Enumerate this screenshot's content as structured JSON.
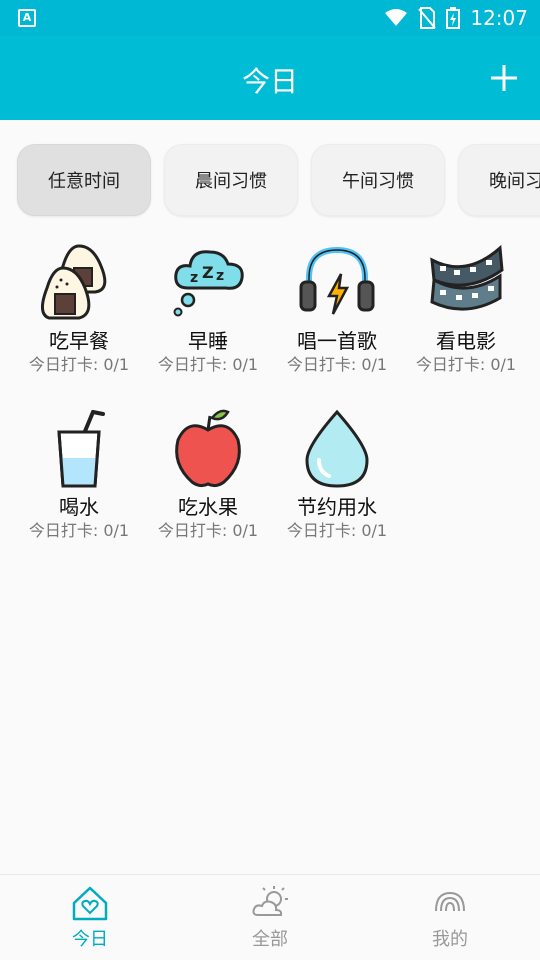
{
  "status": {
    "app_badge": "A",
    "time": "12:07"
  },
  "appbar": {
    "title": "今日",
    "add_icon": "plus-icon"
  },
  "chips": [
    {
      "label": "任意时间",
      "active": true
    },
    {
      "label": "晨间习惯",
      "active": false
    },
    {
      "label": "午间习惯",
      "active": false
    },
    {
      "label": "晚间习惯",
      "active": false
    }
  ],
  "habits": [
    {
      "name": "吃早餐",
      "count": "今日打卡: 0/1",
      "icon": "rice-ball-icon"
    },
    {
      "name": "早睡",
      "count": "今日打卡: 0/1",
      "icon": "sleep-cloud-icon"
    },
    {
      "name": "唱一首歌",
      "count": "今日打卡: 0/1",
      "icon": "headphones-icon"
    },
    {
      "name": "看电影",
      "count": "今日打卡: 0/1",
      "icon": "film-strip-icon"
    },
    {
      "name": "喝水",
      "count": "今日打卡: 0/1",
      "icon": "water-glass-icon"
    },
    {
      "name": "吃水果",
      "count": "今日打卡: 0/1",
      "icon": "apple-icon"
    },
    {
      "name": "节约用水",
      "count": "今日打卡: 0/1",
      "icon": "water-drop-icon"
    }
  ],
  "bottom_nav": [
    {
      "label": "今日",
      "icon": "home-heart-icon",
      "active": true
    },
    {
      "label": "全部",
      "icon": "weather-sun-cloud-icon",
      "active": false
    },
    {
      "label": "我的",
      "icon": "rainbow-icon",
      "active": false
    }
  ],
  "colors": {
    "primary": "#00bcd4",
    "accent_text": "#00acc1"
  }
}
